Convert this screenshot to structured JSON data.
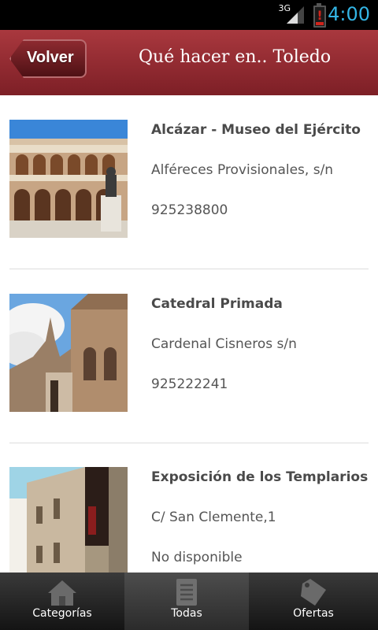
{
  "status_bar": {
    "network": "3G",
    "time": "4:00"
  },
  "header": {
    "back_label": "Volver",
    "title": "Qué hacer en.. Toledo"
  },
  "places": [
    {
      "name": "Alcázar - Museo del Ejército",
      "address": "Alféreces Provisionales, s/n",
      "phone": "925238800"
    },
    {
      "name": "Catedral Primada",
      "address": "Cardenal Cisneros s/n",
      "phone": "925222241"
    },
    {
      "name": "Exposición de los Templarios",
      "address": "C/ San Clemente,1",
      "phone": "No disponible"
    }
  ],
  "tabs": [
    {
      "label": "Categorías",
      "icon": "house-icon"
    },
    {
      "label": "Todas",
      "icon": "document-icon"
    },
    {
      "label": "Ofertas",
      "icon": "tag-icon"
    }
  ],
  "active_tab": "Todas",
  "colors": {
    "header": "#a9383e",
    "clock": "#33b5e5"
  }
}
